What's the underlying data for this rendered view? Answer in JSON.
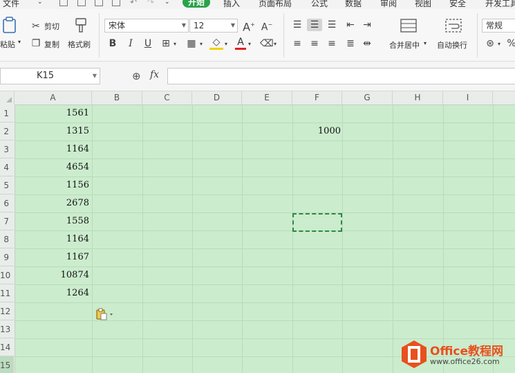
{
  "menu": {
    "file": "文件",
    "tabs": [
      {
        "label": "开始",
        "active": true
      },
      {
        "label": "插入"
      },
      {
        "label": "页面布局"
      },
      {
        "label": "公式"
      },
      {
        "label": "数据"
      },
      {
        "label": "审阅"
      },
      {
        "label": "视图"
      },
      {
        "label": "安全"
      },
      {
        "label": "开发工具"
      }
    ]
  },
  "ribbon": {
    "paste": "粘贴",
    "cut": "剪切",
    "copy": "复制",
    "format_painter": "格式刷",
    "font_name": "宋体",
    "font_size": "12",
    "merge_center": "合并居中",
    "wrap_text": "自动换行",
    "number_format": "常规"
  },
  "formula_bar": {
    "name_box": "K15",
    "fx": "fx",
    "value": ""
  },
  "columns": [
    "A",
    "B",
    "C",
    "D",
    "E",
    "F",
    "G",
    "H",
    "I"
  ],
  "rows": [
    "1",
    "2",
    "3",
    "4",
    "5",
    "6",
    "7",
    "8",
    "9",
    "10",
    "11",
    "12",
    "13",
    "14",
    "15"
  ],
  "column_a_values": [
    "1561",
    "1315",
    "1164",
    "4654",
    "1156",
    "2678",
    "1558",
    "1164",
    "1167",
    "10874",
    "1264"
  ],
  "copied_cell": {
    "ref": "F2",
    "value": "1000"
  },
  "watermark": {
    "brand": "Office教程网",
    "url": "www.office26.com"
  },
  "colors": {
    "accent": "#2aa24a",
    "grid_bg": "#cbeccd",
    "logo_orange": "#e8501e"
  }
}
